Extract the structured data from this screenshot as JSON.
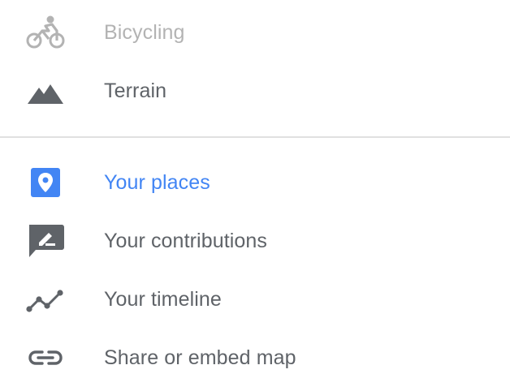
{
  "menu": {
    "items": [
      {
        "label": "Bicycling",
        "icon": "bicycle-icon",
        "state": "disabled"
      },
      {
        "label": "Terrain",
        "icon": "terrain-icon",
        "state": "normal"
      },
      {
        "label": "Your places",
        "icon": "place-pin-icon",
        "state": "highlighted"
      },
      {
        "label": "Your contributions",
        "icon": "edit-comment-icon",
        "state": "normal"
      },
      {
        "label": "Your timeline",
        "icon": "timeline-icon",
        "state": "normal"
      },
      {
        "label": "Share or embed map",
        "icon": "link-icon",
        "state": "normal"
      }
    ]
  },
  "colors": {
    "text": "#5f6368",
    "disabled_text": "#b3b3b3",
    "accent": "#4285f4",
    "icon": "#5f6368",
    "divider": "#e0e0e0"
  }
}
